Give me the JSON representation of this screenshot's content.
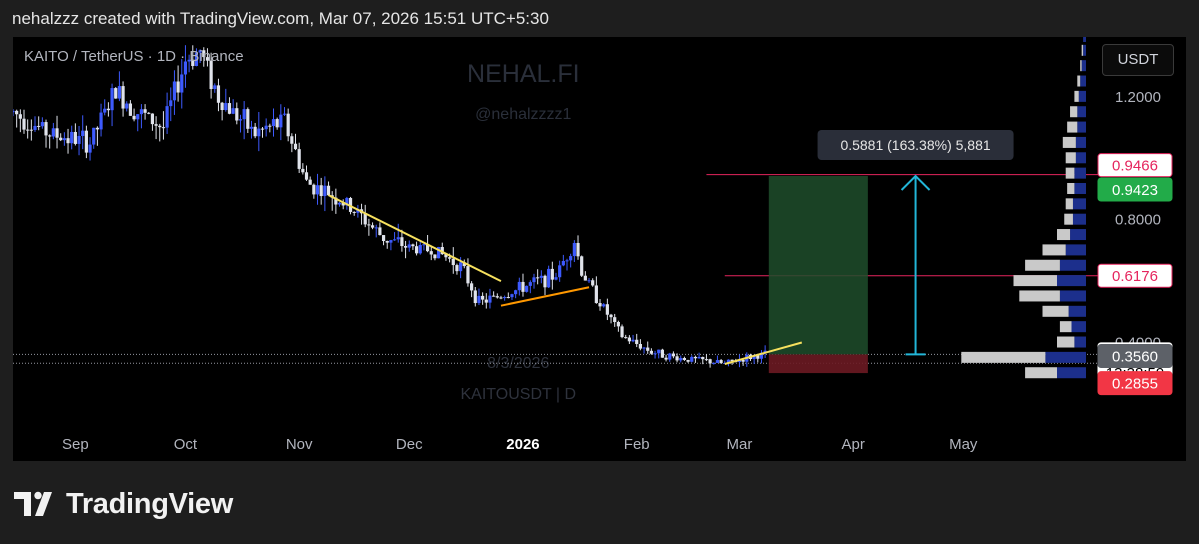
{
  "header": {
    "attribution": "nehalzzz created with TradingView.com, Mar 07, 2026 15:51 UTC+5:30"
  },
  "footer": {
    "brand": "TradingView"
  },
  "chart_data": {
    "type": "candlestick",
    "title": "KAITO / TetherUS · 1D · Binance",
    "watermark": {
      "line1": "NEHAL.FI",
      "line2": "@nehalzzzz1",
      "line3": "8/3/2026",
      "line4": "KAITOUSDT | D"
    },
    "currency": "USDT",
    "x_range": [
      "2025-08-15",
      "2026-06-04"
    ],
    "y_range": [
      0.19,
      1.395
    ],
    "x_ticks": [
      {
        "date": "2025-09-01",
        "label": "Sep",
        "bold": false
      },
      {
        "date": "2025-10-01",
        "label": "Oct",
        "bold": false
      },
      {
        "date": "2025-11-01",
        "label": "Nov",
        "bold": false
      },
      {
        "date": "2025-12-01",
        "label": "Dec",
        "bold": false
      },
      {
        "date": "2026-01-01",
        "label": "2026",
        "bold": true
      },
      {
        "date": "2026-02-01",
        "label": "Feb",
        "bold": false
      },
      {
        "date": "2026-03-01",
        "label": "Mar",
        "bold": false
      },
      {
        "date": "2026-04-01",
        "label": "Apr",
        "bold": false
      },
      {
        "date": "2026-05-01",
        "label": "May",
        "bold": false
      }
    ],
    "y_ticks": [
      {
        "value": 1.2,
        "label": "1.2000"
      },
      {
        "value": 0.8,
        "label": "0.8000"
      },
      {
        "value": 0.4,
        "label": "0.4000"
      }
    ],
    "price_tags": [
      {
        "value": 0.9466,
        "label": "0.9466",
        "bg": "#ffffff",
        "fg": "#e5245d",
        "border": "#e5245d"
      },
      {
        "value": 0.9423,
        "label": "0.9423",
        "bg": "#22ab49",
        "fg": "#ffffff",
        "border": "#22ab49"
      },
      {
        "value": 0.6176,
        "label": "0.6176",
        "bg": "#ffffff",
        "fg": "#e5245d",
        "border": "#e5245d"
      },
      {
        "value": 0.3613,
        "label": "0.3613",
        "sublabel": "13:38:59",
        "bg": "#ffffff",
        "fg": "#000000",
        "border": "#ffffff"
      },
      {
        "value": 0.356,
        "label": "0.3560",
        "bg": "#5d6168",
        "fg": "#ffffff",
        "border": "#5d6168"
      },
      {
        "value": 0.2855,
        "label": "0.2855",
        "bg": "#f23645",
        "fg": "#ffffff",
        "border": "#f23645"
      }
    ],
    "price_series": [
      {
        "date": "2025-08-15",
        "price": 1.15
      },
      {
        "date": "2025-08-25",
        "price": 1.08
      },
      {
        "date": "2025-09-05",
        "price": 1.05
      },
      {
        "date": "2025-09-12",
        "price": 1.22
      },
      {
        "date": "2025-09-18",
        "price": 1.15
      },
      {
        "date": "2025-09-25",
        "price": 1.1
      },
      {
        "date": "2025-10-01",
        "price": 1.32
      },
      {
        "date": "2025-10-05",
        "price": 1.35
      },
      {
        "date": "2025-10-10",
        "price": 1.2
      },
      {
        "date": "2025-10-20",
        "price": 1.08
      },
      {
        "date": "2025-10-28",
        "price": 1.12
      },
      {
        "date": "2025-11-03",
        "price": 0.92
      },
      {
        "date": "2025-11-10",
        "price": 0.88
      },
      {
        "date": "2025-11-17",
        "price": 0.82
      },
      {
        "date": "2025-11-24",
        "price": 0.74
      },
      {
        "date": "2025-12-01",
        "price": 0.71
      },
      {
        "date": "2025-12-08",
        "price": 0.7
      },
      {
        "date": "2025-12-15",
        "price": 0.65
      },
      {
        "date": "2025-12-20",
        "price": 0.53
      },
      {
        "date": "2025-12-28",
        "price": 0.56
      },
      {
        "date": "2026-01-05",
        "price": 0.6
      },
      {
        "date": "2026-01-10",
        "price": 0.62
      },
      {
        "date": "2026-01-15",
        "price": 0.73
      },
      {
        "date": "2026-01-17",
        "price": 0.63
      },
      {
        "date": "2026-01-22",
        "price": 0.53
      },
      {
        "date": "2026-01-28",
        "price": 0.42
      },
      {
        "date": "2026-02-05",
        "price": 0.37
      },
      {
        "date": "2026-02-12",
        "price": 0.35
      },
      {
        "date": "2026-02-20",
        "price": 0.34
      },
      {
        "date": "2026-02-25",
        "price": 0.33
      },
      {
        "date": "2026-03-03",
        "price": 0.35
      },
      {
        "date": "2026-03-08",
        "price": 0.3613
      }
    ],
    "horizontal_lines": [
      {
        "value": 0.9466,
        "from": "2026-02-20",
        "color": "#e5245d"
      },
      {
        "value": 0.6176,
        "from": "2026-02-25",
        "color": "#e5245d"
      },
      {
        "value": 0.3613,
        "from": "2025-08-15",
        "color": "#9598a1",
        "style": "dotted"
      },
      {
        "value": 0.3323,
        "from": "2025-08-15",
        "color": "#9598a1",
        "style": "dotted"
      }
    ],
    "trendlines": [
      {
        "color": "#f6e05e",
        "from": {
          "date": "2025-11-09",
          "price": 0.88
        },
        "to": {
          "date": "2025-12-26",
          "price": 0.6
        }
      },
      {
        "color": "#ff9800",
        "from": {
          "date": "2025-12-26",
          "price": 0.52
        },
        "to": {
          "date": "2026-01-19",
          "price": 0.58
        }
      },
      {
        "color": "#f6e05e",
        "from": {
          "date": "2026-02-25",
          "price": 0.33
        },
        "to": {
          "date": "2026-03-18",
          "price": 0.4
        }
      }
    ],
    "position": {
      "entry": 0.3613,
      "target": 0.9423,
      "stop": 0.3005,
      "start": "2026-03-09",
      "end": "2026-04-05",
      "profit_color": "#1e4d2b",
      "loss_color": "#6b1a22"
    },
    "measure": {
      "date": "2026-04-18",
      "from": 0.3613,
      "to": 0.9423,
      "label": "0.5881 (163.38%) 5,881",
      "color": "#22b6d8"
    },
    "volume_profile": [
      {
        "price": 1.395,
        "buy": 2,
        "sell": 0
      },
      {
        "price": 1.35,
        "buy": 2,
        "sell": 1
      },
      {
        "price": 1.3,
        "buy": 3,
        "sell": 1
      },
      {
        "price": 1.25,
        "buy": 4,
        "sell": 2
      },
      {
        "price": 1.2,
        "buy": 5,
        "sell": 3
      },
      {
        "price": 1.15,
        "buy": 6,
        "sell": 5
      },
      {
        "price": 1.1,
        "buy": 6,
        "sell": 7
      },
      {
        "price": 1.05,
        "buy": 7,
        "sell": 9
      },
      {
        "price": 1.0,
        "buy": 7,
        "sell": 7
      },
      {
        "price": 0.95,
        "buy": 8,
        "sell": 6
      },
      {
        "price": 0.9,
        "buy": 8,
        "sell": 5
      },
      {
        "price": 0.85,
        "buy": 9,
        "sell": 5
      },
      {
        "price": 0.8,
        "buy": 9,
        "sell": 6
      },
      {
        "price": 0.75,
        "buy": 11,
        "sell": 9
      },
      {
        "price": 0.7,
        "buy": 14,
        "sell": 16
      },
      {
        "price": 0.65,
        "buy": 18,
        "sell": 24
      },
      {
        "price": 0.6,
        "buy": 20,
        "sell": 30
      },
      {
        "price": 0.55,
        "buy": 18,
        "sell": 28
      },
      {
        "price": 0.5,
        "buy": 12,
        "sell": 18
      },
      {
        "price": 0.45,
        "buy": 10,
        "sell": 8
      },
      {
        "price": 0.4,
        "buy": 8,
        "sell": 12
      },
      {
        "price": 0.35,
        "buy": 28,
        "sell": 58
      },
      {
        "price": 0.3,
        "buy": 20,
        "sell": 22
      }
    ]
  }
}
